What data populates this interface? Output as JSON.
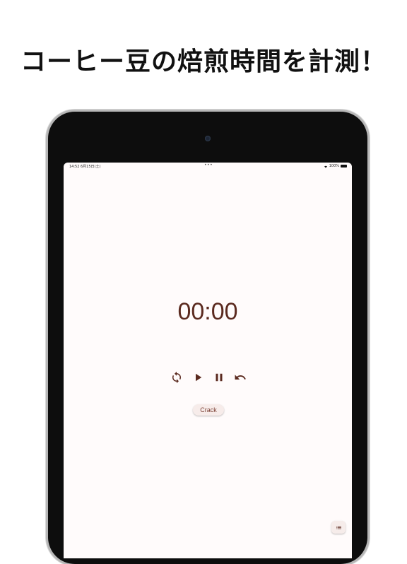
{
  "headline": "コーヒー豆の焙煎時間を計測！",
  "status_bar": {
    "time": "14:52  6月15日(土)",
    "dots": "•••",
    "battery": "100%"
  },
  "timer": {
    "display": "00:00"
  },
  "controls": {
    "icons": [
      "refresh-icon",
      "play-icon",
      "pause-icon",
      "undo-icon"
    ]
  },
  "crack_button": {
    "label": "Crack"
  },
  "fab": {
    "icon": "list-icon"
  },
  "colors": {
    "accent": "#5b2a1f",
    "screen_bg": "#fffbfb",
    "device": "#0d0d0d"
  }
}
